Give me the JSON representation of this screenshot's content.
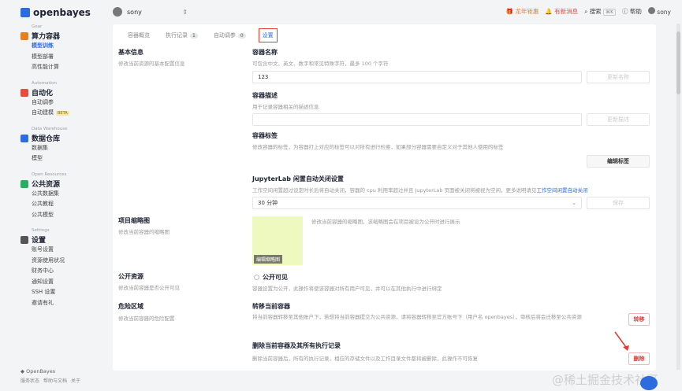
{
  "brand": {
    "name": "openbayes",
    "color": "#2d6cdf"
  },
  "workspace": {
    "name": "sony",
    "chevron": "⌃⌄"
  },
  "topbar": {
    "promo": "龙年钜惠",
    "messages": "有新消息",
    "search": "搜索",
    "search_kbd": "⌘K",
    "help": "帮助",
    "user": "sony"
  },
  "sidebar": {
    "groups": [
      {
        "en": "Gear",
        "title": "算力容器",
        "color": "#e67e22",
        "items": [
          "模型训练",
          "模型部署",
          "高性能计算"
        ],
        "active": 0
      },
      {
        "en": "Automation",
        "title": "自动化",
        "color": "#e74c3c",
        "items": [
          "自动调参",
          "自动建模"
        ],
        "beta_on": 1,
        "beta": "BETA"
      },
      {
        "en": "Data Warehouse",
        "title": "数据仓库",
        "color": "#2d6cdf",
        "items": [
          "数据集",
          "模型"
        ]
      },
      {
        "en": "Open Resources",
        "title": "公共资源",
        "color": "#27ae60",
        "items": [
          "公共数据集",
          "公共教程",
          "公共模型"
        ]
      },
      {
        "en": "Settings",
        "title": "设置",
        "color": "#555555",
        "items": [
          "账号设置",
          "资源使用状况",
          "财务中心",
          "通知设置",
          "SSH 设置",
          "邀请有礼"
        ]
      }
    ],
    "footer_brand": "OpenBayes",
    "footer_links": [
      "服务状态",
      "帮助与文档",
      "关于"
    ]
  },
  "tabs": [
    {
      "label": "容器概览",
      "count": ""
    },
    {
      "label": "执行记录",
      "count": "1"
    },
    {
      "label": "自动调参",
      "count": "0"
    },
    {
      "label": "设置",
      "count": ""
    }
  ],
  "basic": {
    "title": "基本信息",
    "desc": "修改当前资源的基本配置信息"
  },
  "name": {
    "label": "容器名称",
    "hint": "可包含中文、英文、数字和常见特殊字符，最多 100 个字符",
    "value": "123",
    "btn": "更新名称"
  },
  "description": {
    "label": "容器描述",
    "hint": "用于记录容器相关的描述信息",
    "btn": "更新描述"
  },
  "tags": {
    "label": "容器标签",
    "hint": "修改容器的标签，为容器打上对应的标签可以对所有进行检索，如果部分容器需要自定义对于其他人使用的标签",
    "btn": "编辑标签"
  },
  "jupyter": {
    "label": "JupyterLab 闲置自动关闭设置",
    "hint": "工作空间闲置超过设定时长后将自动关闭，容器的 cpu 利用率超过并且 JupyterLab 页面被关闭将被视为空闲，更多说明请见",
    "link": "工作空间闲置自动关闭",
    "value": "30 分钟",
    "btn": "保存"
  },
  "cover": {
    "title": "项目缩略图",
    "desc": "修改当前容器的缩略图",
    "hint": "修改当前容器的缩略图，该缩略图会在项目被设为公开时进行展示",
    "btn": "编辑缩略图",
    "color": "#eef9bf"
  },
  "public": {
    "title": "公开资源",
    "desc": "修改当前容器是否公开可见",
    "option": "公开可见",
    "hint": "容器设置为公开，此操作将使该容器对所有用户可见，并可以在其他执行中进行绑定"
  },
  "danger": {
    "title": "危险区域",
    "desc": "修改当前容器的危险配置"
  },
  "transfer": {
    "label": "转移当前容器",
    "hint": "将当前容器转移至其他账户下，若想将当前容器提交为公共资源，请将容器转移至官方账号下（用户名 openbayes），审核后将会迁移至公共资源",
    "btn": "转移"
  },
  "delete": {
    "label": "删除当前容器及其所有执行记录",
    "hint": "删除当前容器后，所有的执行记录，相应的存储文件以及工作目录文件都将被删除，此操作不可恢复",
    "btn": "删除"
  },
  "watermark": "@稀土掘金技术社区"
}
